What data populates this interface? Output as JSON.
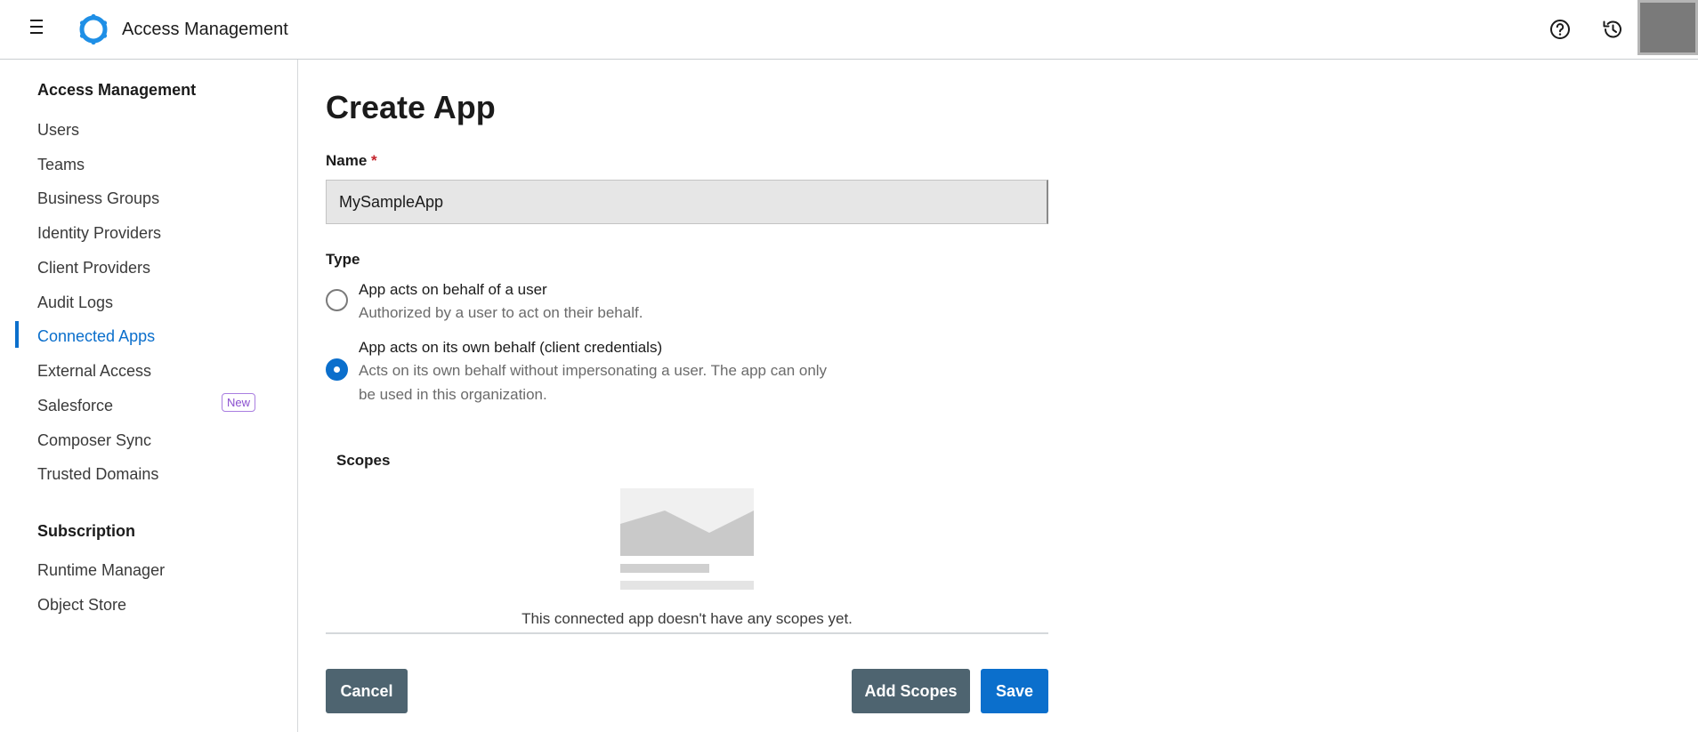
{
  "header": {
    "title": "Access Management",
    "menu_icon": "hamburger-menu-icon",
    "logo_icon": "ring-logo-icon",
    "help_icon": "help-circle-icon",
    "history_icon": "history-clock-icon"
  },
  "sidebar": {
    "section1_heading": "Access Management",
    "items": [
      {
        "label": "Users"
      },
      {
        "label": "Teams"
      },
      {
        "label": "Business Groups"
      },
      {
        "label": "Identity Providers"
      },
      {
        "label": "Client Providers"
      },
      {
        "label": "Audit Logs"
      },
      {
        "label": "Connected Apps",
        "active": true
      },
      {
        "label": "External Access"
      },
      {
        "label": "Salesforce",
        "badge": "New"
      },
      {
        "label": "Composer Sync"
      },
      {
        "label": "Trusted Domains"
      }
    ],
    "section2_heading": "Subscription",
    "items2": [
      {
        "label": "Runtime Manager"
      },
      {
        "label": "Object Store"
      }
    ]
  },
  "main": {
    "page_title": "Create App",
    "name_label": "Name",
    "name_required_mark": "*",
    "name_value": "MySampleApp",
    "type_label": "Type",
    "options": [
      {
        "title": "App acts on behalf of a user",
        "description_lines": [
          "Authorized by a user to act on their behalf."
        ],
        "checked": false
      },
      {
        "title": "App acts on its own behalf (client credentials)",
        "description_lines": [
          "Acts on its own behalf without impersonating a user. The app can only",
          "be used in this organization."
        ],
        "checked": true
      }
    ],
    "scopes_label": "Scopes",
    "scopes_empty_text": "This connected app doesn't have any scopes yet.",
    "buttons": {
      "cancel": "Cancel",
      "add_scopes": "Add Scopes",
      "save": "Save"
    }
  },
  "colors": {
    "accent": "#0b6fcc",
    "secondary_button": "#4e6470",
    "badge": "#8a4fcf",
    "required": "#c4232b"
  }
}
